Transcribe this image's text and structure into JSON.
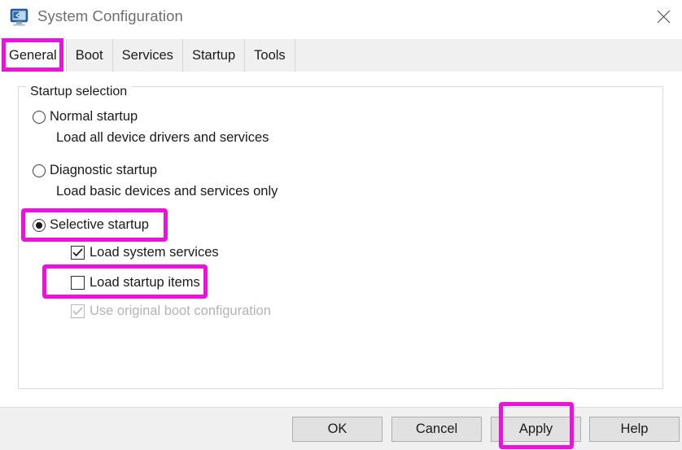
{
  "window": {
    "title": "System Configuration",
    "icon": "system-configuration-icon",
    "close_label": "✕"
  },
  "tabs": [
    {
      "label": "General",
      "active": true
    },
    {
      "label": "Boot",
      "active": false
    },
    {
      "label": "Services",
      "active": false
    },
    {
      "label": "Startup",
      "active": false
    },
    {
      "label": "Tools",
      "active": false
    }
  ],
  "startup_selection": {
    "legend": "Startup selection",
    "options": [
      {
        "label": "Normal startup",
        "description": "Load all device drivers and services",
        "selected": false
      },
      {
        "label": "Diagnostic startup",
        "description": "Load basic devices and services only",
        "selected": false
      },
      {
        "label": "Selective startup",
        "description": "",
        "selected": true
      }
    ],
    "checkboxes": [
      {
        "label": "Load system services",
        "checked": true,
        "disabled": false
      },
      {
        "label": "Load startup items",
        "checked": false,
        "disabled": false
      },
      {
        "label": "Use original boot configuration",
        "checked": true,
        "disabled": true
      }
    ]
  },
  "footer": {
    "ok_label": "OK",
    "cancel_label": "Cancel",
    "apply_label": "Apply",
    "help_label": "Help"
  },
  "annotations": {
    "color": "#ee11dd",
    "targets": [
      "general-tab",
      "selective-startup-radio",
      "load-startup-items-checkbox",
      "apply-button"
    ]
  }
}
